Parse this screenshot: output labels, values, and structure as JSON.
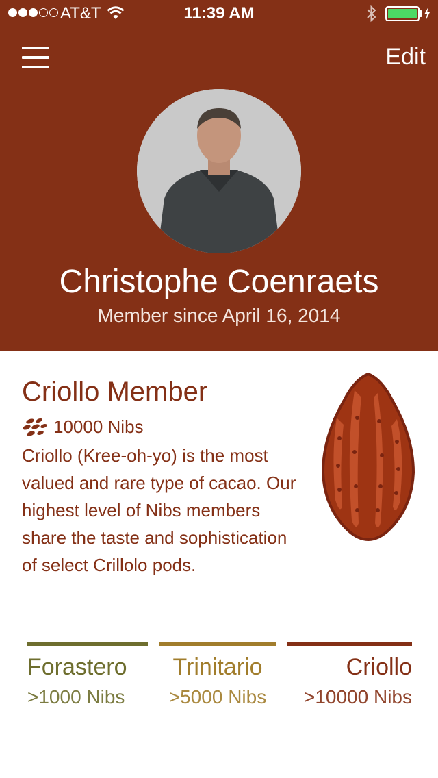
{
  "status_bar": {
    "carrier": "AT&T",
    "time": "11:39 AM",
    "signal_bars_filled": 3,
    "signal_bars_total": 5,
    "battery_fill": 1.0,
    "battery_color": "#4cd964"
  },
  "header": {
    "menu_icon": "hamburger-menu-icon",
    "edit_label": "Edit",
    "background_color": "#843016"
  },
  "profile": {
    "name": "Christophe Coenraets",
    "member_since": "Member since April 16, 2014"
  },
  "membership": {
    "title": "Criollo Member",
    "nibs_icon": "nibs-icon",
    "nibs_count": "10000 Nibs",
    "description": "Criollo (Kree-oh-yo) is the most valued and rare type of cacao. Our highest level of Nibs members share the taste and sophistication of select Crillolo pods.",
    "illustration": "cacao-pod"
  },
  "tiers": [
    {
      "name": "Forastero",
      "requirement": ">1000 Nibs",
      "color": "#6e6e2e"
    },
    {
      "name": "Trinitario",
      "requirement": ">5000 Nibs",
      "color": "#a17d2c"
    },
    {
      "name": "Criollo",
      "requirement": ">10000 Nibs",
      "color": "#843016"
    }
  ]
}
